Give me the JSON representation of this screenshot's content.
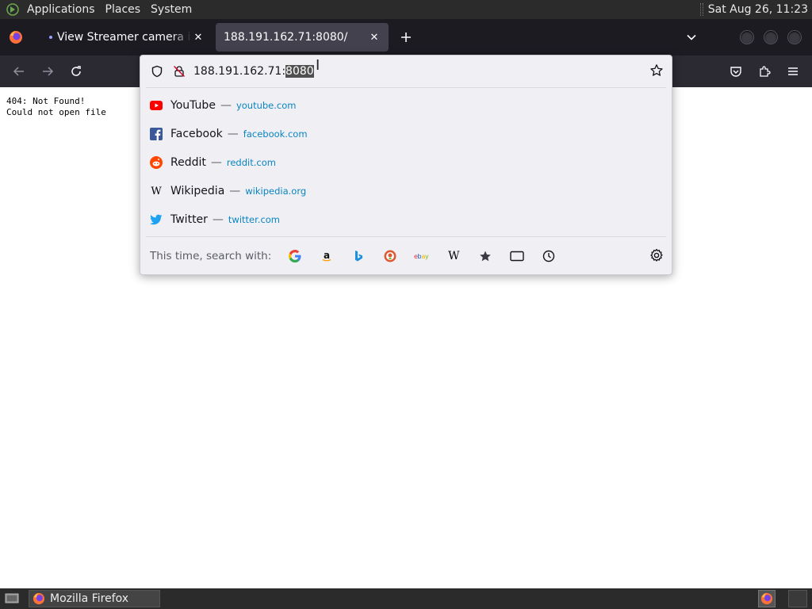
{
  "top_panel": {
    "menus": [
      "Applications",
      "Places",
      "System"
    ],
    "clock": "Sat Aug 26, 11:23"
  },
  "tabs": [
    {
      "title": "View Streamer camera in Ru",
      "active": false,
      "icon": "tab-dot-icon"
    },
    {
      "title": "188.191.162.71:8080/",
      "active": true,
      "icon": null
    }
  ],
  "urlbar": {
    "text_unselected": "188.191.162.71:",
    "text_selected": "8080"
  },
  "suggestions": [
    {
      "title": "YouTube",
      "url": "youtube.com",
      "icon": "youtube-icon",
      "color": "#ff0000"
    },
    {
      "title": "Facebook",
      "url": "facebook.com",
      "icon": "facebook-icon",
      "color": "#3b5998"
    },
    {
      "title": "Reddit",
      "url": "reddit.com",
      "icon": "reddit-icon",
      "color": "#ff4500"
    },
    {
      "title": "Wikipedia",
      "url": "wikipedia.org",
      "icon": "wikipedia-icon",
      "color": "#000000"
    },
    {
      "title": "Twitter",
      "url": "twitter.com",
      "icon": "twitter-icon",
      "color": "#1da1f2"
    }
  ],
  "separator": "—",
  "search_with": {
    "label": "This time, search with:",
    "engines": [
      "google-icon",
      "amazon-icon",
      "bing-icon",
      "duckduckgo-icon",
      "ebay-icon",
      "wikipedia-icon",
      "bookmarks-icon",
      "tabs-icon",
      "history-icon"
    ]
  },
  "page": {
    "lines": [
      "404: Not Found!",
      "Could not open file"
    ]
  },
  "taskbar": {
    "window_title": "Mozilla Firefox"
  },
  "colors": {
    "accent": "#0a84c1",
    "toolbar": "#2b2a33",
    "tabstrip": "#1c1b22"
  }
}
